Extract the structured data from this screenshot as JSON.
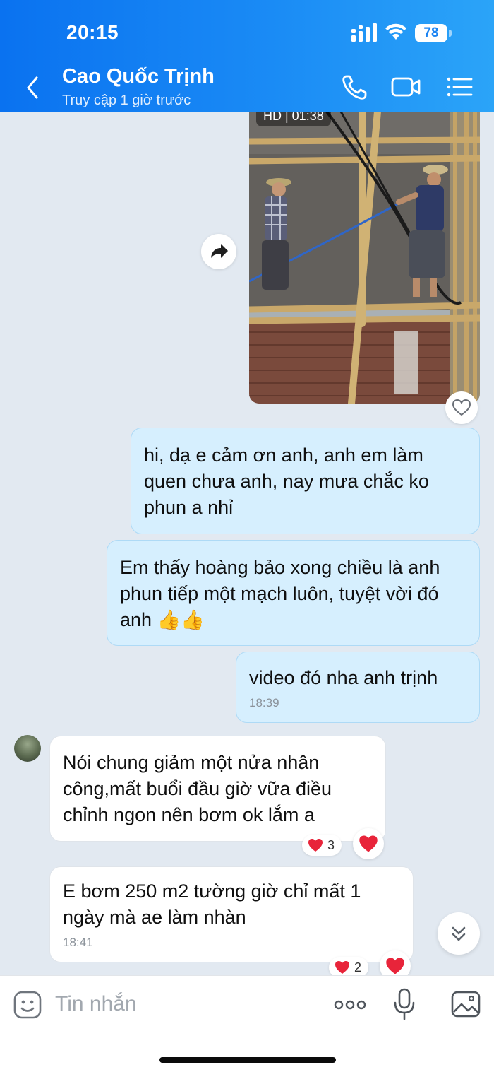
{
  "status_bar": {
    "time": "20:15",
    "battery": "78"
  },
  "header": {
    "contact_name": "Cao Quốc Trịnh",
    "status": "Truy cập 1 giờ trước",
    "icons": [
      "back-arrow-icon",
      "phone-icon",
      "video-call-icon",
      "list-menu-icon"
    ]
  },
  "video_message": {
    "badge": "HD | 01:38"
  },
  "messages": [
    {
      "direction": "outgoing",
      "text": "hi, dạ e cảm ơn anh, anh em làm quen chưa anh, nay mưa chắc ko phun a nhỉ"
    },
    {
      "direction": "outgoing",
      "text": "Em thấy hoàng bảo xong chiều là anh phun tiếp một mạch luôn, tuyệt vời đó anh",
      "emoji": "👍👍"
    },
    {
      "direction": "outgoing",
      "text": "video đó nha anh trịnh",
      "time": "18:39"
    },
    {
      "direction": "incoming",
      "text": "Nói chung giảm một nửa nhân công,mất buổi đầu giờ vữa điều chỉnh ngon nên bơm ok lắm a",
      "reaction_count": "3"
    },
    {
      "direction": "incoming",
      "text": "E bơm 250 m2 tường giờ chỉ mất 1 ngày mà ae làm nhàn",
      "time": "18:41",
      "reaction_count": "2"
    }
  ],
  "composer": {
    "placeholder": "Tin nhắn"
  },
  "colors": {
    "header_start": "#0a72f0",
    "header_end": "#2ba4f8",
    "outgoing_bubble": "#d6effe",
    "incoming_bubble": "#ffffff",
    "heart": "#e8243a",
    "background": "#e2e9f1"
  }
}
